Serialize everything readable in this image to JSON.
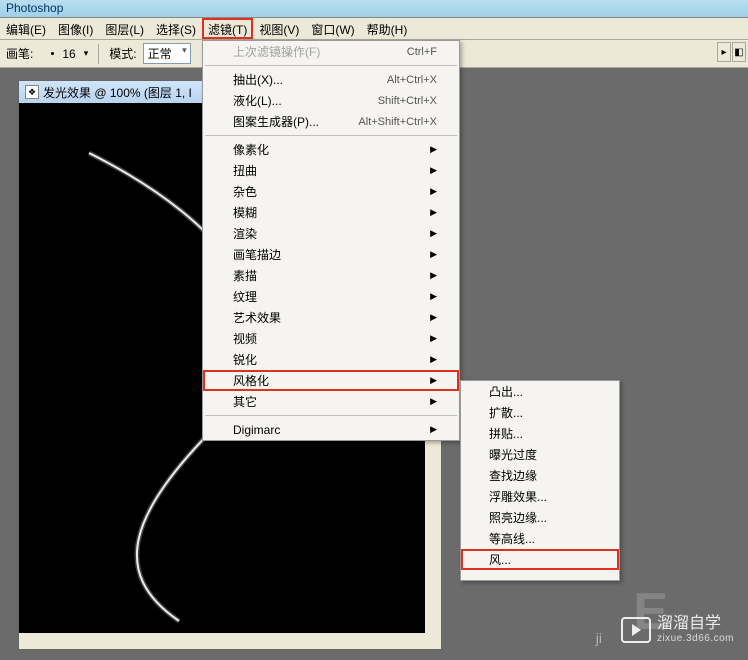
{
  "app": {
    "title": "Photoshop"
  },
  "menubar": [
    {
      "label": "编辑(E)",
      "key": "edit"
    },
    {
      "label": "图像(I)",
      "key": "image"
    },
    {
      "label": "图层(L)",
      "key": "layer"
    },
    {
      "label": "选择(S)",
      "key": "select"
    },
    {
      "label": "滤镜(T)",
      "key": "filter",
      "active": true
    },
    {
      "label": "视图(V)",
      "key": "view"
    },
    {
      "label": "窗口(W)",
      "key": "window"
    },
    {
      "label": "帮助(H)",
      "key": "help"
    }
  ],
  "toolbar": {
    "brush_label": "画笔:",
    "brush_size": "16",
    "mode_label": "模式:",
    "mode_value": "正常"
  },
  "document": {
    "title": "发光效果 @ 100% (图层 1, I"
  },
  "filter_menu": {
    "last_filter": {
      "label": "上次滤镜操作(F)",
      "shortcut": "Ctrl+F",
      "disabled": true
    },
    "items1": [
      {
        "label": "抽出(X)...",
        "shortcut": "Alt+Ctrl+X"
      },
      {
        "label": "液化(L)...",
        "shortcut": "Shift+Ctrl+X"
      },
      {
        "label": "图案生成器(P)...",
        "shortcut": "Alt+Shift+Ctrl+X"
      }
    ],
    "items2": [
      {
        "label": "像素化",
        "submenu": true
      },
      {
        "label": "扭曲",
        "submenu": true
      },
      {
        "label": "杂色",
        "submenu": true
      },
      {
        "label": "模糊",
        "submenu": true
      },
      {
        "label": "渲染",
        "submenu": true
      },
      {
        "label": "画笔描边",
        "submenu": true
      },
      {
        "label": "素描",
        "submenu": true
      },
      {
        "label": "纹理",
        "submenu": true
      },
      {
        "label": "艺术效果",
        "submenu": true
      },
      {
        "label": "视频",
        "submenu": true
      },
      {
        "label": "锐化",
        "submenu": true
      },
      {
        "label": "风格化",
        "submenu": true,
        "highlighted": true
      },
      {
        "label": "其它",
        "submenu": true
      }
    ],
    "items3": [
      {
        "label": "Digimarc",
        "submenu": true
      }
    ]
  },
  "stylize_submenu": [
    {
      "label": "凸出..."
    },
    {
      "label": "扩散..."
    },
    {
      "label": "拼贴..."
    },
    {
      "label": "曝光过度"
    },
    {
      "label": "查找边缘"
    },
    {
      "label": "浮雕效果..."
    },
    {
      "label": "照亮边缘..."
    },
    {
      "label": "等高线..."
    },
    {
      "label": "风...",
      "highlighted": true
    }
  ],
  "watermark": {
    "brand": "溜溜自学",
    "url": "zixue.3d66.com"
  }
}
